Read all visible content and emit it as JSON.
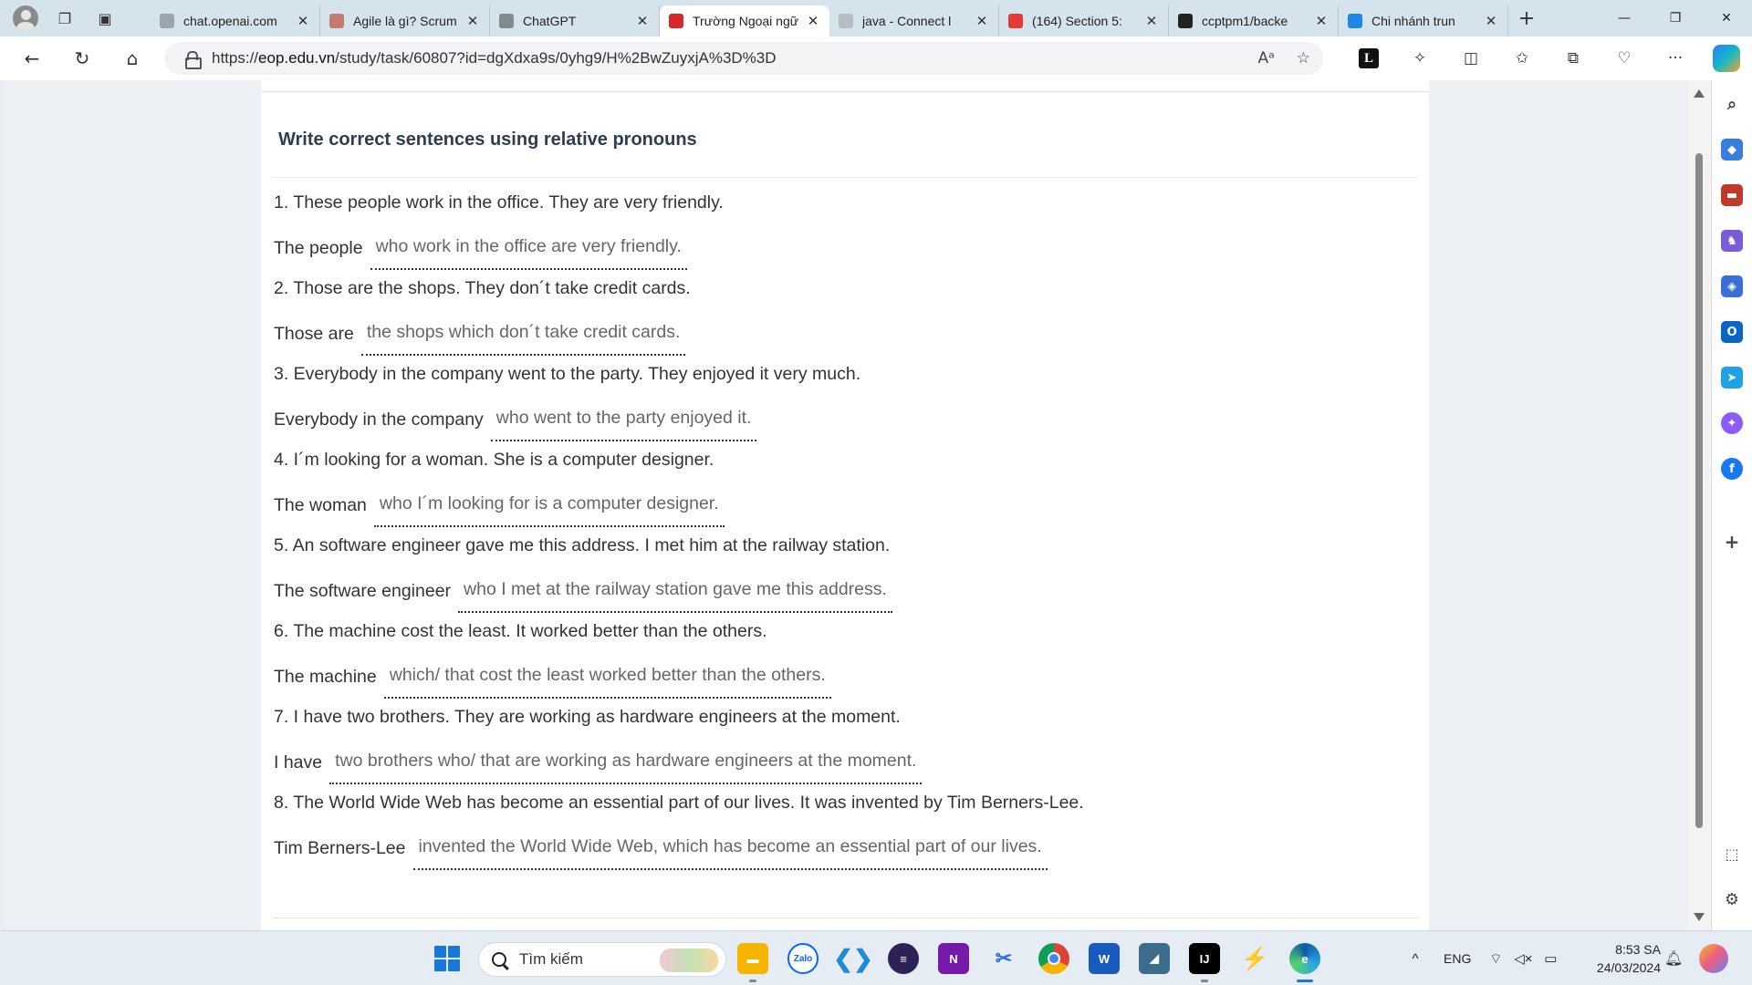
{
  "browser": {
    "tabs": [
      {
        "title": "chat.openai.com",
        "favicon_color": "#9aa5ad",
        "active": false
      },
      {
        "title": "Agile là gì? Scrum",
        "favicon_color": "#c27b6e",
        "active": false
      },
      {
        "title": "ChatGPT",
        "favicon_color": "#7f8c8d",
        "active": false
      },
      {
        "title": "Trường Ngoại ngữ",
        "favicon_color": "#d62828",
        "active": true
      },
      {
        "title": "java - Connect l",
        "favicon_color": "#b7bcc0",
        "active": false
      },
      {
        "title": "(164) Section 5:",
        "favicon_color": "#e53935",
        "active": false
      },
      {
        "title": "ccptpm1/backe",
        "favicon_color": "#222222",
        "active": false
      },
      {
        "title": "Chi nhánh trun",
        "favicon_color": "#1e88e5",
        "active": false
      }
    ],
    "url": {
      "prefix": "https://",
      "host": "eop.edu.vn",
      "path": "/study/task/60807?id=dgXdxa9s/0yhg9/H%2BwZuyxjA%3D%3D"
    }
  },
  "exercise": {
    "title": "Write correct sentences using relative pronouns",
    "items": [
      {
        "prompt": "1. These people work in the office. They are very friendly.",
        "lead": "The people",
        "answer": "who work in the office are very friendly."
      },
      {
        "prompt": "2. Those are the shops. They don´t take credit cards.",
        "lead": "Those are",
        "answer": "the shops which don´t take credit cards."
      },
      {
        "prompt": "3. Everybody in the company went to the party. They enjoyed it very much.",
        "lead": "Everybody in the company",
        "answer": "who went to the party enjoyed it."
      },
      {
        "prompt": "4. I´m looking for a woman. She is a computer designer.",
        "lead": "The woman",
        "answer": "who I´m looking for is a computer designer."
      },
      {
        "prompt": "5. An software engineer gave me this address. I met him at the railway station.",
        "lead": "The software engineer",
        "answer": "who I met at the railway station gave me this address."
      },
      {
        "prompt": "6. The machine cost the least. It worked better than the others.",
        "lead": "The machine",
        "answer": "which/ that cost the least worked better than the others."
      },
      {
        "prompt": "7. I have two brothers. They are working as hardware engineers at the moment.",
        "lead": "I have",
        "answer": "two brothers who/ that are working as hardware engineers at the moment."
      },
      {
        "prompt": "8. The World Wide Web has become an essential part of our lives. It was invented by Tim Berners-Lee.",
        "lead": "Tim Berners-Lee",
        "answer": "invented the World Wide Web, which has become an essential part of our lives."
      }
    ]
  },
  "taskbar": {
    "search_placeholder": "Tìm kiếm",
    "language": "ENG",
    "time": "8:53 SA",
    "date": "24/03/2024"
  },
  "colors": {
    "accent": "#1877d8",
    "active_tab_favicon": "#d62828"
  }
}
